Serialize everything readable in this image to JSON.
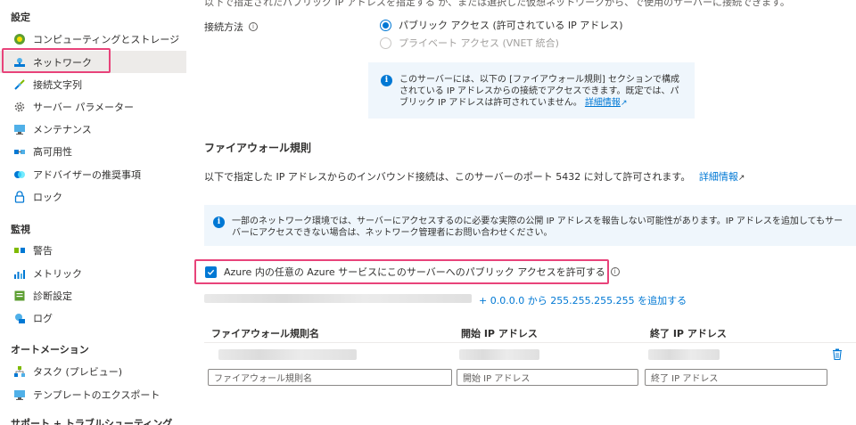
{
  "sidebar": {
    "settings_header": "設定",
    "settings_items": [
      {
        "label": "コンピューティングとストレージ",
        "icon": "compute-icon"
      },
      {
        "label": "ネットワーク",
        "icon": "network-icon"
      },
      {
        "label": "接続文字列",
        "icon": "connection-string-icon"
      },
      {
        "label": "サーバー パラメーター",
        "icon": "gear-icon"
      },
      {
        "label": "メンテナンス",
        "icon": "maintenance-icon"
      },
      {
        "label": "高可用性",
        "icon": "high-availability-icon"
      },
      {
        "label": "アドバイザーの推奨事項",
        "icon": "advisor-icon"
      },
      {
        "label": "ロック",
        "icon": "lock-icon"
      }
    ],
    "monitoring_header": "監視",
    "monitoring_items": [
      {
        "label": "警告",
        "icon": "alert-icon"
      },
      {
        "label": "メトリック",
        "icon": "metrics-icon"
      },
      {
        "label": "診断設定",
        "icon": "diagnostic-icon"
      },
      {
        "label": "ログ",
        "icon": "logs-icon"
      }
    ],
    "automation_header": "オートメーション",
    "automation_items": [
      {
        "label": "タスク (プレビュー)",
        "icon": "tasks-icon"
      },
      {
        "label": "テンプレートのエクスポート",
        "icon": "export-template-icon"
      }
    ],
    "support_header": "サポート + トラブルシューティング"
  },
  "main": {
    "top_cut_text": "以下で指定されたパブリック IP アドレスを指定する か、または選択した仮想ネットワークから、で使用のサーバーに接続できます。",
    "connection_method_label": "接続方法",
    "radio_public": "パブリック アクセス (許可されている IP アドレス)",
    "radio_private": "プライベート アクセス (VNET 統合)",
    "info1_text": "このサーバーには、以下の [ファイアウォール規則] セクションで構成されている IP アドレスからの接続でアクセスできます。既定では、パブリック IP アドレスは許可されていません。",
    "info1_link": "詳細情報",
    "firewall_heading": "ファイアウォール規則",
    "firewall_desc": "以下で指定した IP アドレスからのインバウンド接続は、このサーバーのポート 5432 に対して許可されます。",
    "firewall_link": "詳細情報",
    "info2_text": "一部のネットワーク環境では、サーバーにアクセスするのに必要な実際の公開 IP アドレスを報告しない可能性があります。IP アドレスを追加してもサーバーにアクセスできない場合は、ネットワーク管理者にお問い合わせください。",
    "checkbox_label": "Azure 内の任意の Azure サービスにこのサーバーへのパブリック アクセスを許可する",
    "add_range_link": "+ 0.0.0.0 から 255.255.255.255 を追加する",
    "col_rule_name": "ファイアウォール規則名",
    "col_start_ip": "開始 IP アドレス",
    "col_end_ip": "終了 IP アドレス",
    "placeholder_rule_name": "ファイアウォール規則名",
    "placeholder_start_ip": "開始 IP アドレス",
    "placeholder_end_ip": "終了 IP アドレス"
  },
  "colors": {
    "accent": "#0078d4",
    "highlight": "#e8437a",
    "selected_bg": "#edebe9",
    "info_bg": "#eff6fc"
  }
}
